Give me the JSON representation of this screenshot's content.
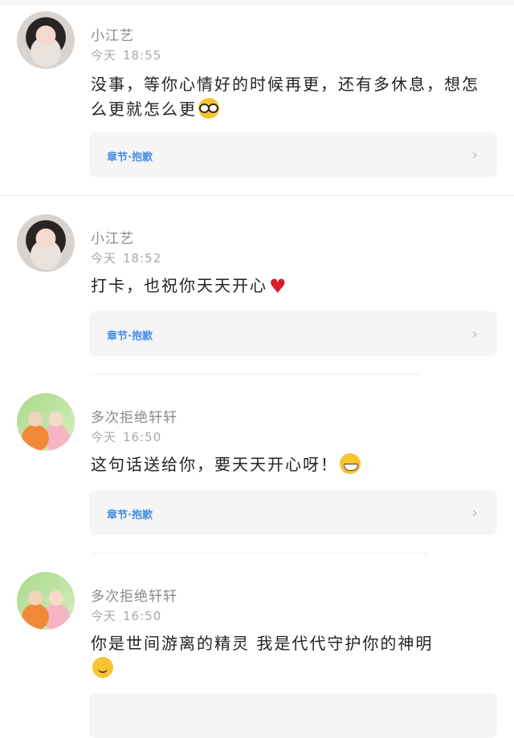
{
  "comments": [
    {
      "username": "小江艺",
      "date": "今天",
      "time": "18:55",
      "text": "没事，等你心情好的时候再更，还有多休息，想怎么更就怎么更",
      "emoji": "nerd-face-emoji",
      "chapter_label": "章节·抱歉"
    },
    {
      "username": "小江艺",
      "date": "今天",
      "time": "18:52",
      "text": "打卡，也祝你天天开心",
      "emoji": "red-heart-emoji",
      "chapter_label": "章节·抱歉"
    },
    {
      "username": "多次拒绝轩轩",
      "date": "今天",
      "time": "16:50",
      "text": "这句话送给你，要天天开心呀！",
      "emoji": "grinning-face-emoji",
      "chapter_label": "章节·抱歉"
    },
    {
      "username": "多次拒绝轩轩",
      "date": "今天",
      "time": "16:50",
      "text": "你是世间游离的精灵 我是代代守护你的神明",
      "emoji": "smiling-face-emoji",
      "chapter_label": ""
    }
  ],
  "colors": {
    "chapter_link": "#4a90e2",
    "meta_text": "#a8a8a8",
    "card_bg": "#f5f5f5",
    "heart": "#d81e2c"
  },
  "icons": {
    "chevron": "chevron-right-icon"
  }
}
